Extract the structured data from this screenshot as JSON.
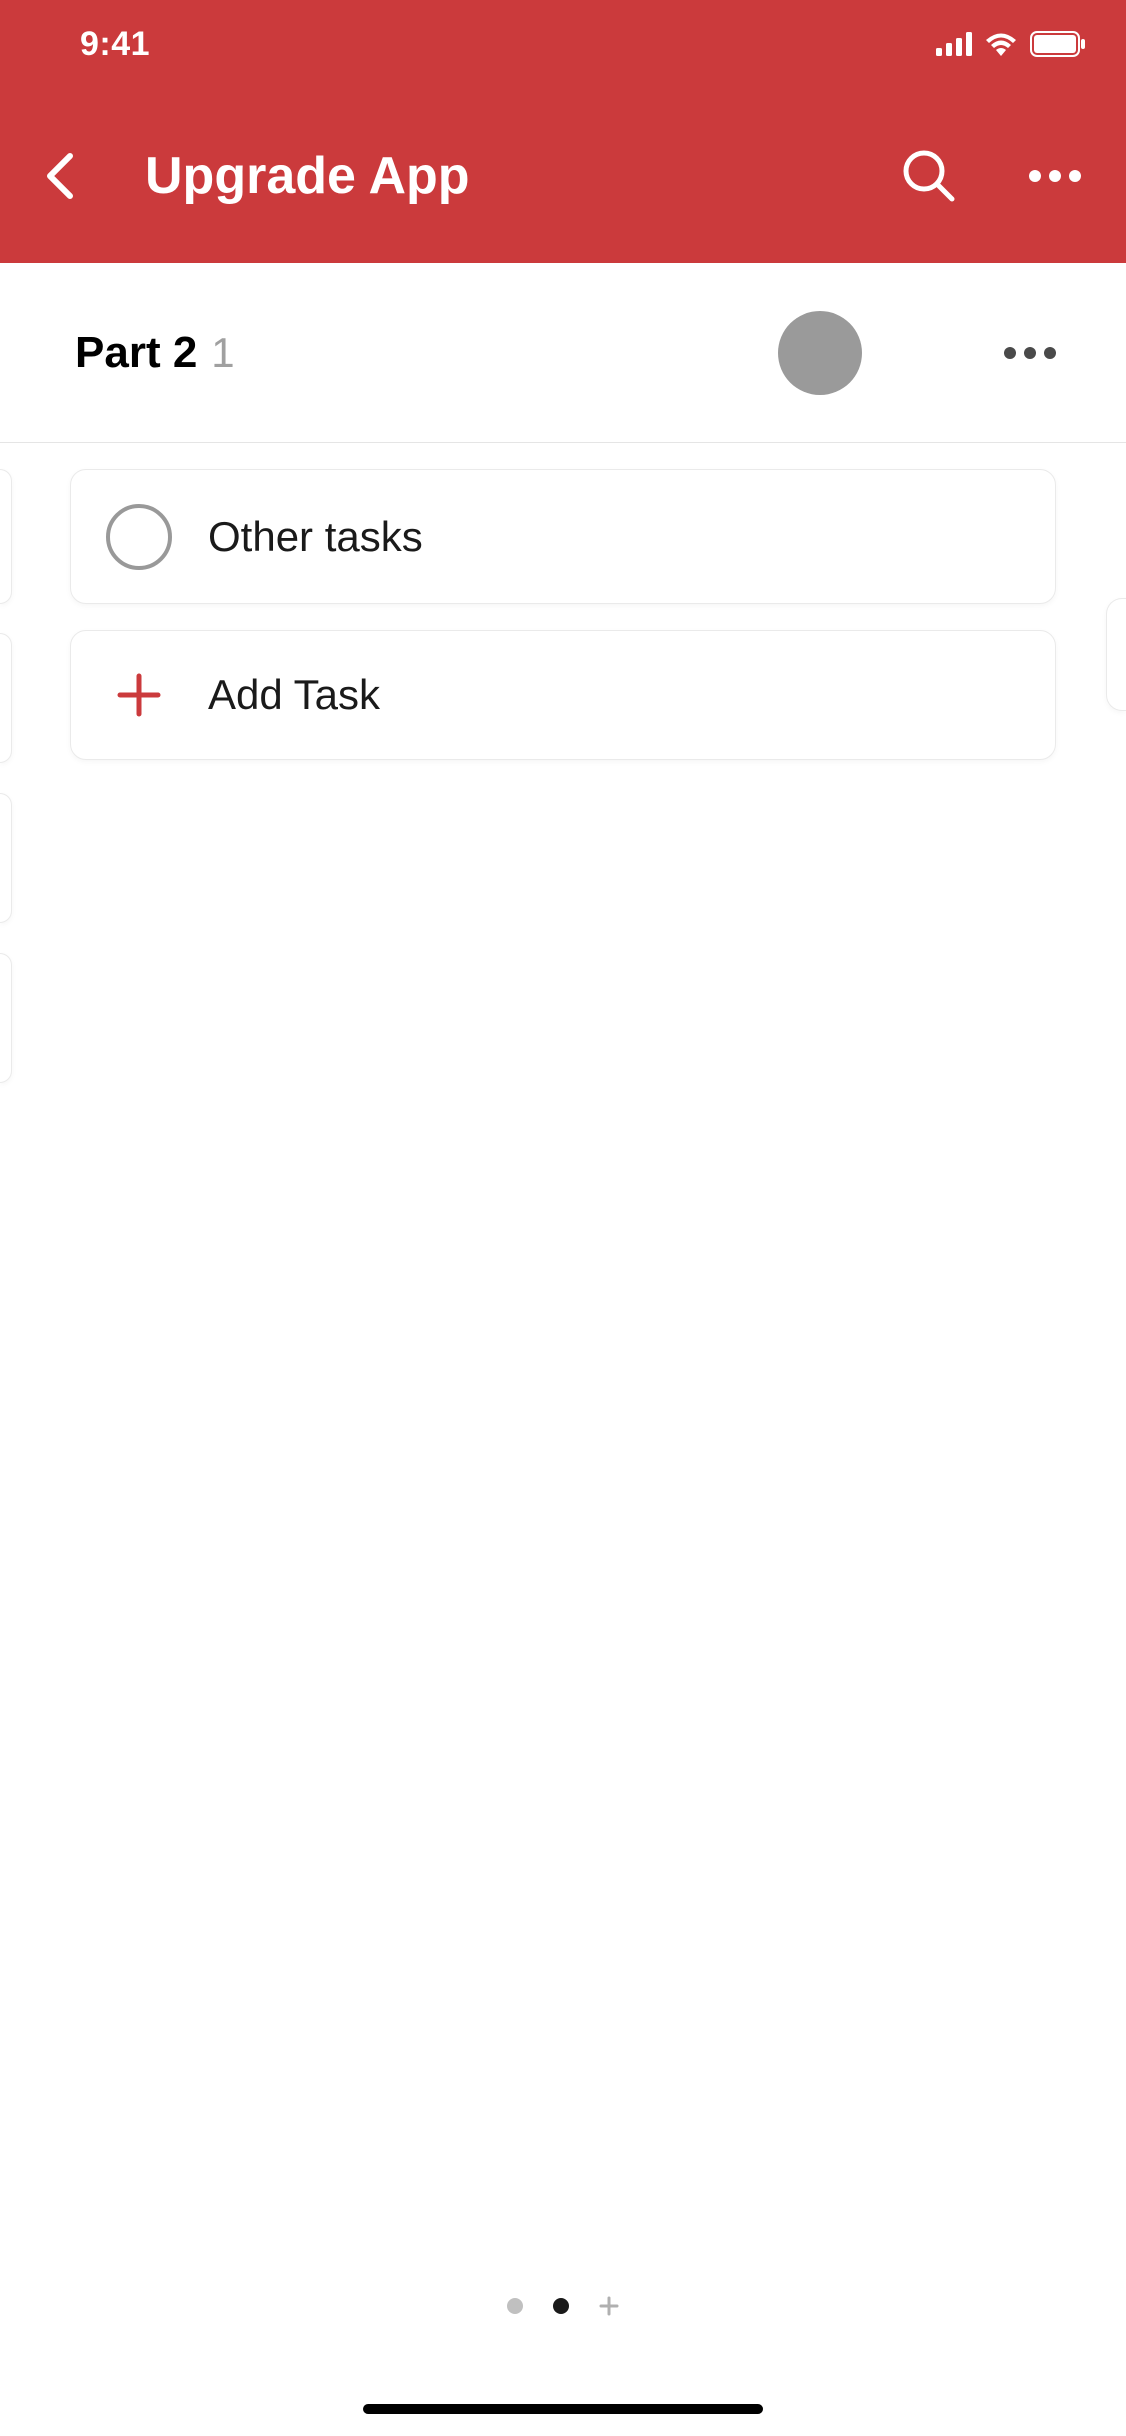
{
  "status": {
    "time": "9:41"
  },
  "nav": {
    "title": "Upgrade App"
  },
  "section": {
    "title": "Part 2",
    "count": "1"
  },
  "tasks": [
    {
      "label": "Other tasks"
    }
  ],
  "addTask": {
    "label": "Add Task"
  },
  "colors": {
    "brand": "#cb3a3c"
  }
}
